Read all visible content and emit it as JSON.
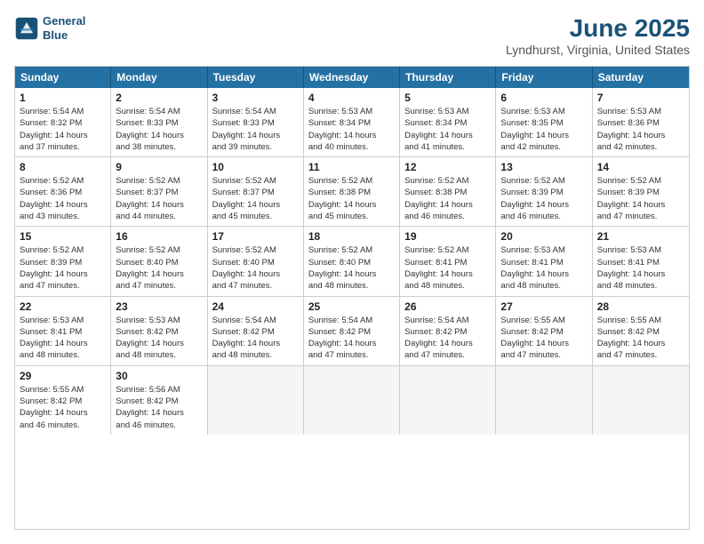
{
  "logo": {
    "line1": "General",
    "line2": "Blue"
  },
  "title": "June 2025",
  "subtitle": "Lyndhurst, Virginia, United States",
  "header": {
    "days": [
      "Sunday",
      "Monday",
      "Tuesday",
      "Wednesday",
      "Thursday",
      "Friday",
      "Saturday"
    ]
  },
  "weeks": [
    {
      "cells": [
        {
          "day": "1",
          "info": "Sunrise: 5:54 AM\nSunset: 8:32 PM\nDaylight: 14 hours\nand 37 minutes."
        },
        {
          "day": "2",
          "info": "Sunrise: 5:54 AM\nSunset: 8:33 PM\nDaylight: 14 hours\nand 38 minutes."
        },
        {
          "day": "3",
          "info": "Sunrise: 5:54 AM\nSunset: 8:33 PM\nDaylight: 14 hours\nand 39 minutes."
        },
        {
          "day": "4",
          "info": "Sunrise: 5:53 AM\nSunset: 8:34 PM\nDaylight: 14 hours\nand 40 minutes."
        },
        {
          "day": "5",
          "info": "Sunrise: 5:53 AM\nSunset: 8:34 PM\nDaylight: 14 hours\nand 41 minutes."
        },
        {
          "day": "6",
          "info": "Sunrise: 5:53 AM\nSunset: 8:35 PM\nDaylight: 14 hours\nand 42 minutes."
        },
        {
          "day": "7",
          "info": "Sunrise: 5:53 AM\nSunset: 8:36 PM\nDaylight: 14 hours\nand 42 minutes."
        }
      ]
    },
    {
      "cells": [
        {
          "day": "8",
          "info": "Sunrise: 5:52 AM\nSunset: 8:36 PM\nDaylight: 14 hours\nand 43 minutes."
        },
        {
          "day": "9",
          "info": "Sunrise: 5:52 AM\nSunset: 8:37 PM\nDaylight: 14 hours\nand 44 minutes."
        },
        {
          "day": "10",
          "info": "Sunrise: 5:52 AM\nSunset: 8:37 PM\nDaylight: 14 hours\nand 45 minutes."
        },
        {
          "day": "11",
          "info": "Sunrise: 5:52 AM\nSunset: 8:38 PM\nDaylight: 14 hours\nand 45 minutes."
        },
        {
          "day": "12",
          "info": "Sunrise: 5:52 AM\nSunset: 8:38 PM\nDaylight: 14 hours\nand 46 minutes."
        },
        {
          "day": "13",
          "info": "Sunrise: 5:52 AM\nSunset: 8:39 PM\nDaylight: 14 hours\nand 46 minutes."
        },
        {
          "day": "14",
          "info": "Sunrise: 5:52 AM\nSunset: 8:39 PM\nDaylight: 14 hours\nand 47 minutes."
        }
      ]
    },
    {
      "cells": [
        {
          "day": "15",
          "info": "Sunrise: 5:52 AM\nSunset: 8:39 PM\nDaylight: 14 hours\nand 47 minutes."
        },
        {
          "day": "16",
          "info": "Sunrise: 5:52 AM\nSunset: 8:40 PM\nDaylight: 14 hours\nand 47 minutes."
        },
        {
          "day": "17",
          "info": "Sunrise: 5:52 AM\nSunset: 8:40 PM\nDaylight: 14 hours\nand 47 minutes."
        },
        {
          "day": "18",
          "info": "Sunrise: 5:52 AM\nSunset: 8:40 PM\nDaylight: 14 hours\nand 48 minutes."
        },
        {
          "day": "19",
          "info": "Sunrise: 5:52 AM\nSunset: 8:41 PM\nDaylight: 14 hours\nand 48 minutes."
        },
        {
          "day": "20",
          "info": "Sunrise: 5:53 AM\nSunset: 8:41 PM\nDaylight: 14 hours\nand 48 minutes."
        },
        {
          "day": "21",
          "info": "Sunrise: 5:53 AM\nSunset: 8:41 PM\nDaylight: 14 hours\nand 48 minutes."
        }
      ]
    },
    {
      "cells": [
        {
          "day": "22",
          "info": "Sunrise: 5:53 AM\nSunset: 8:41 PM\nDaylight: 14 hours\nand 48 minutes."
        },
        {
          "day": "23",
          "info": "Sunrise: 5:53 AM\nSunset: 8:42 PM\nDaylight: 14 hours\nand 48 minutes."
        },
        {
          "day": "24",
          "info": "Sunrise: 5:54 AM\nSunset: 8:42 PM\nDaylight: 14 hours\nand 48 minutes."
        },
        {
          "day": "25",
          "info": "Sunrise: 5:54 AM\nSunset: 8:42 PM\nDaylight: 14 hours\nand 47 minutes."
        },
        {
          "day": "26",
          "info": "Sunrise: 5:54 AM\nSunset: 8:42 PM\nDaylight: 14 hours\nand 47 minutes."
        },
        {
          "day": "27",
          "info": "Sunrise: 5:55 AM\nSunset: 8:42 PM\nDaylight: 14 hours\nand 47 minutes."
        },
        {
          "day": "28",
          "info": "Sunrise: 5:55 AM\nSunset: 8:42 PM\nDaylight: 14 hours\nand 47 minutes."
        }
      ]
    },
    {
      "cells": [
        {
          "day": "29",
          "info": "Sunrise: 5:55 AM\nSunset: 8:42 PM\nDaylight: 14 hours\nand 46 minutes."
        },
        {
          "day": "30",
          "info": "Sunrise: 5:56 AM\nSunset: 8:42 PM\nDaylight: 14 hours\nand 46 minutes."
        },
        {
          "day": "",
          "info": ""
        },
        {
          "day": "",
          "info": ""
        },
        {
          "day": "",
          "info": ""
        },
        {
          "day": "",
          "info": ""
        },
        {
          "day": "",
          "info": ""
        }
      ]
    }
  ]
}
